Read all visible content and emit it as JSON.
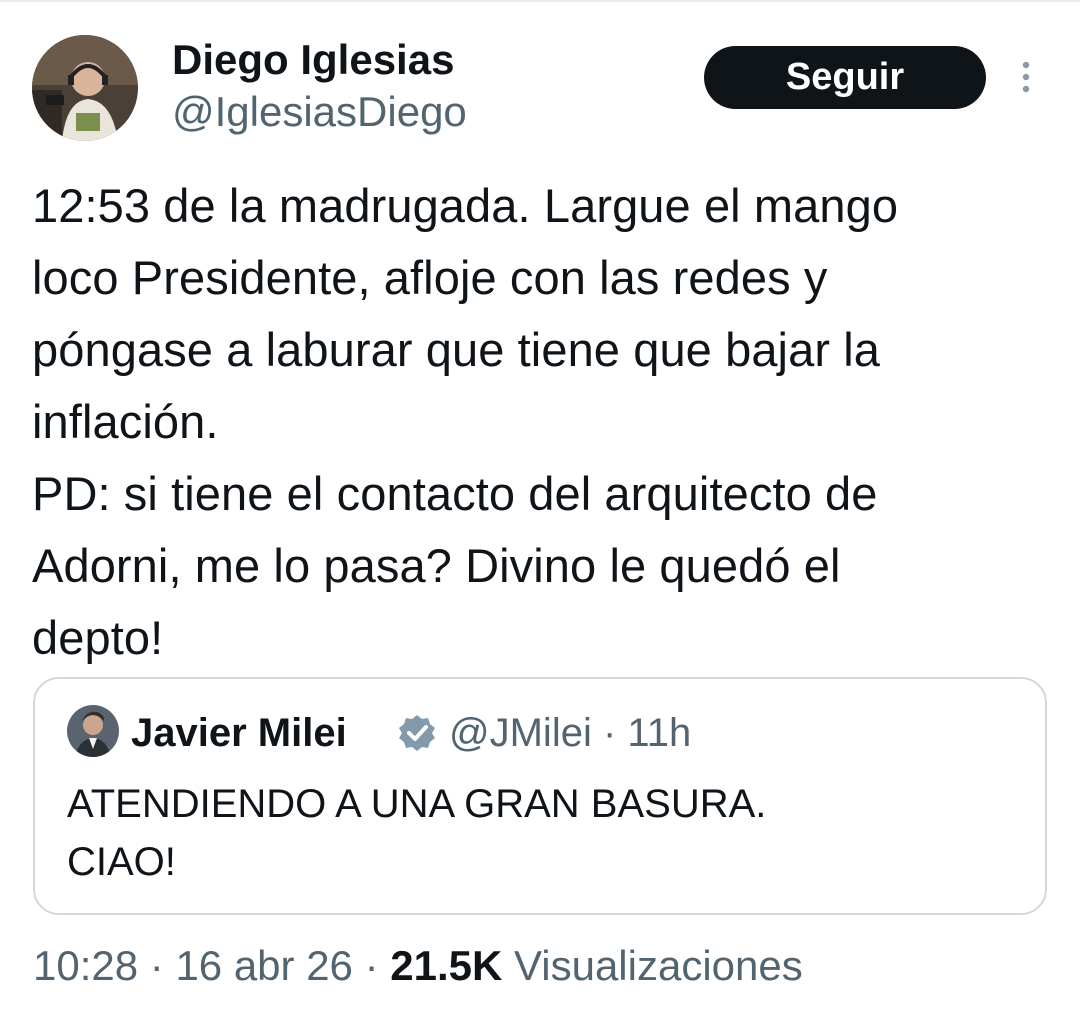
{
  "author": {
    "name": "Diego Iglesias",
    "handle": "@IglesiasDiego"
  },
  "follow_button": {
    "label": "Seguir"
  },
  "icons": {
    "more": "more-vertical-icon",
    "verified": "verified-badge-icon"
  },
  "tweet": {
    "text": "12:53 de la madrugada. Largue el mango\nloco Presidente, afloje con las redes y\npóngase a laburar que tiene que bajar la\ninflación.\nPD: si tiene el contacto del arquitecto de\nAdorni, me lo pasa? Divino le quedó el\ndepto!"
  },
  "quoted": {
    "name": "Javier Milei",
    "handle": "@JMilei",
    "separator": "·",
    "time": "11h",
    "text": "ATENDIENDO A UNA GRAN BASURA.\nCIAO!"
  },
  "footer": {
    "time": "10:28",
    "sep1": " · ",
    "date": "16 abr 26",
    "sep2": " · ",
    "views_count": "21.5K",
    "views_label": " Visualizaciones"
  },
  "colors": {
    "text_primary": "#0f1419",
    "text_secondary": "#536471",
    "button_bg": "#0f1419",
    "border": "#cfd9de",
    "verified_badge": "#829aab"
  }
}
